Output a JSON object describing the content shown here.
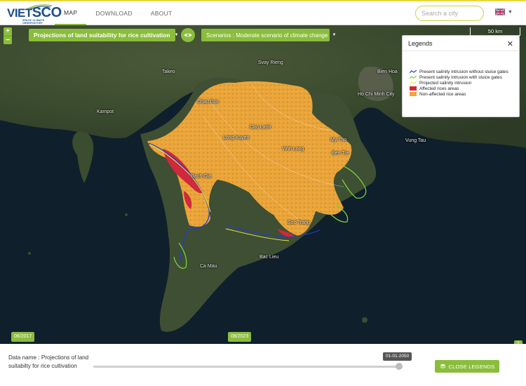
{
  "app": {
    "logo_text_a": "VIET",
    "logo_text_b": "SCO",
    "logo_sub": "SPACE CLIMATE OBSERVATORY",
    "brand_color": "#1d4f8c",
    "accent_color": "#8bbd3c"
  },
  "nav": {
    "items": [
      {
        "label": "MAP",
        "active": true
      },
      {
        "label": "DOWNLOAD",
        "active": false
      },
      {
        "label": "ABOUT",
        "active": false
      }
    ]
  },
  "search": {
    "placeholder": "Search a city",
    "value": ""
  },
  "language": {
    "icon": "uk-flag-icon"
  },
  "map": {
    "layer_label": "Projections of land suitability for rice cultivation",
    "scenario_label": "Scenarios : Moderate scenario of climate change",
    "scale_label": "50 km",
    "places": [
      {
        "name": "Svay Rieng"
      },
      {
        "name": "Takeo"
      },
      {
        "name": "Kampot"
      },
      {
        "name": "Bien Hoa"
      },
      {
        "name": "Ho Chi Minh City"
      },
      {
        "name": "Vung Tau"
      },
      {
        "name": "Chau Doc"
      },
      {
        "name": "Cao Lanh"
      },
      {
        "name": "Long Xuyen"
      },
      {
        "name": "Vinh Long"
      },
      {
        "name": "My Tho"
      },
      {
        "name": "Ben Tre"
      },
      {
        "name": "Rach Gia"
      },
      {
        "name": "Soc Trang"
      },
      {
        "name": "Bac Lieu"
      },
      {
        "name": "Ca Mau"
      }
    ]
  },
  "legend": {
    "title": "Legends",
    "items": [
      {
        "label": "Present salinity intrusion without sluice gates",
        "color": "#2a3cc8",
        "kind": "line"
      },
      {
        "label": "Present salinity intrusion with sluice gates",
        "color": "#7ad13a",
        "kind": "line"
      },
      {
        "label": "Projected salinity intrusion",
        "color": "#e8ef4a",
        "kind": "line"
      },
      {
        "label": "Affected rices areas",
        "color": "#d0283c",
        "kind": "fill"
      },
      {
        "label": "Non-affected rice areas",
        "color": "#f1a43a",
        "kind": "fill"
      }
    ]
  },
  "timeline": {
    "start_date": "06/2017",
    "mid_date": "08/2023",
    "selected_date": "01-01-2050",
    "position": 1.0
  },
  "bottom": {
    "data_name_label": "Data name : Projections of land suitabilty for rice cultivation",
    "close_legends_label": "CLOSE LEGENDS"
  }
}
